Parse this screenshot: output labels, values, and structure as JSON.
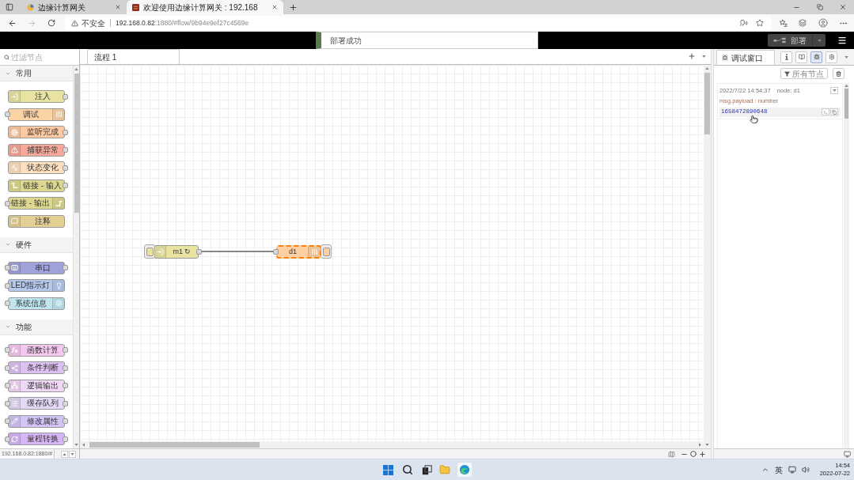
{
  "browser": {
    "tabs": [
      {
        "title": "边缘计算网关",
        "selected": false
      },
      {
        "title": "欢迎使用边缘计算网关 : 192.168",
        "selected": true
      }
    ],
    "address": {
      "security_label": "不安全",
      "host": "192.168.0.82",
      "path": ":1880/#flow/9b94e9ef27c4569e"
    }
  },
  "header": {
    "notification": "部署成功",
    "deploy_button": "部署"
  },
  "palette": {
    "filter": {
      "placeholder": "过滤节点"
    },
    "categories": [
      {
        "label": "常用",
        "expanded": true,
        "nodes": [
          {
            "label": "注入",
            "color": "#e9e3a2",
            "icon_right": false,
            "input": false,
            "output": true
          },
          {
            "label": "调试",
            "color": "#fbd3a5",
            "icon_right": true,
            "input": true,
            "output": false
          },
          {
            "label": "监听完成",
            "color": "#fdc9a2",
            "icon_right": false,
            "input": false,
            "output": true
          },
          {
            "label": "捕获异常",
            "color": "#f7a898",
            "icon_right": false,
            "input": false,
            "output": true
          },
          {
            "label": "状态变化",
            "color": "#fde0bf",
            "icon_right": false,
            "input": false,
            "output": true
          },
          {
            "label": "链接 - 输入",
            "color": "#ddd88f",
            "icon_right": false,
            "input": false,
            "output": true
          },
          {
            "label": "链接 - 输出",
            "color": "#ddd88f",
            "icon_right": true,
            "input": true,
            "output": false
          },
          {
            "label": "注释",
            "color": "#e4cf95",
            "icon_right": false,
            "input": false,
            "output": false
          }
        ]
      },
      {
        "label": "硬件",
        "expanded": true,
        "nodes": [
          {
            "label": "串口",
            "color": "#9fa3d9",
            "icon_right": false,
            "input": true,
            "output": true
          },
          {
            "label": "LED指示灯",
            "color": "#b5c8ec",
            "icon_right": true,
            "input": true,
            "output": false
          },
          {
            "label": "系统信息",
            "color": "#bfe6ef",
            "icon_right": true,
            "input": true,
            "output": false
          }
        ]
      },
      {
        "label": "功能",
        "expanded": true,
        "nodes": [
          {
            "label": "函数计算",
            "color": "#f5c9ef",
            "icon_right": false,
            "input": true,
            "output": true
          },
          {
            "label": "条件判断",
            "color": "#dcc2f3",
            "icon_right": false,
            "input": true,
            "output": true
          },
          {
            "label": "逻辑输出",
            "color": "#f1d7f6",
            "icon_right": false,
            "input": true,
            "output": true
          },
          {
            "label": "缓存队列",
            "color": "#e3d8f5",
            "icon_right": false,
            "input": true,
            "output": true
          },
          {
            "label": "修改属性",
            "color": "#d2c4f5",
            "icon_right": false,
            "input": true,
            "output": true
          },
          {
            "label": "量程转换",
            "color": "#d7b6f6",
            "icon_right": false,
            "input": true,
            "output": true
          }
        ]
      }
    ],
    "status_url": "192.168.0.82:1880/#"
  },
  "workspace": {
    "tabs": [
      {
        "label": "流程 1",
        "selected": true
      }
    ],
    "nodes": [
      {
        "kind": "inject",
        "label": "m1 ↻",
        "color": "#e9e3a2",
        "selected": false
      },
      {
        "kind": "debug",
        "label": "d1",
        "color": "#fdd0a2",
        "selected": true
      }
    ]
  },
  "sidebar": {
    "tabs": [
      {
        "label": "调试窗口",
        "selected": true
      }
    ],
    "tool_buttons": [
      {
        "selected": false
      },
      {
        "selected": false
      },
      {
        "selected": true
      },
      {
        "selected": false
      }
    ],
    "filter_button": "所有节点",
    "messages": [
      {
        "timestamp": "2022/7/22 14:54:37",
        "node": "node: d1",
        "topic": "msg.payload : number",
        "value": "1658472890648"
      }
    ]
  },
  "taskbar": {
    "apps": [
      {
        "active": false
      },
      {
        "active": true
      }
    ],
    "language": "英",
    "time": "14:54",
    "date": "2022-07-22"
  }
}
